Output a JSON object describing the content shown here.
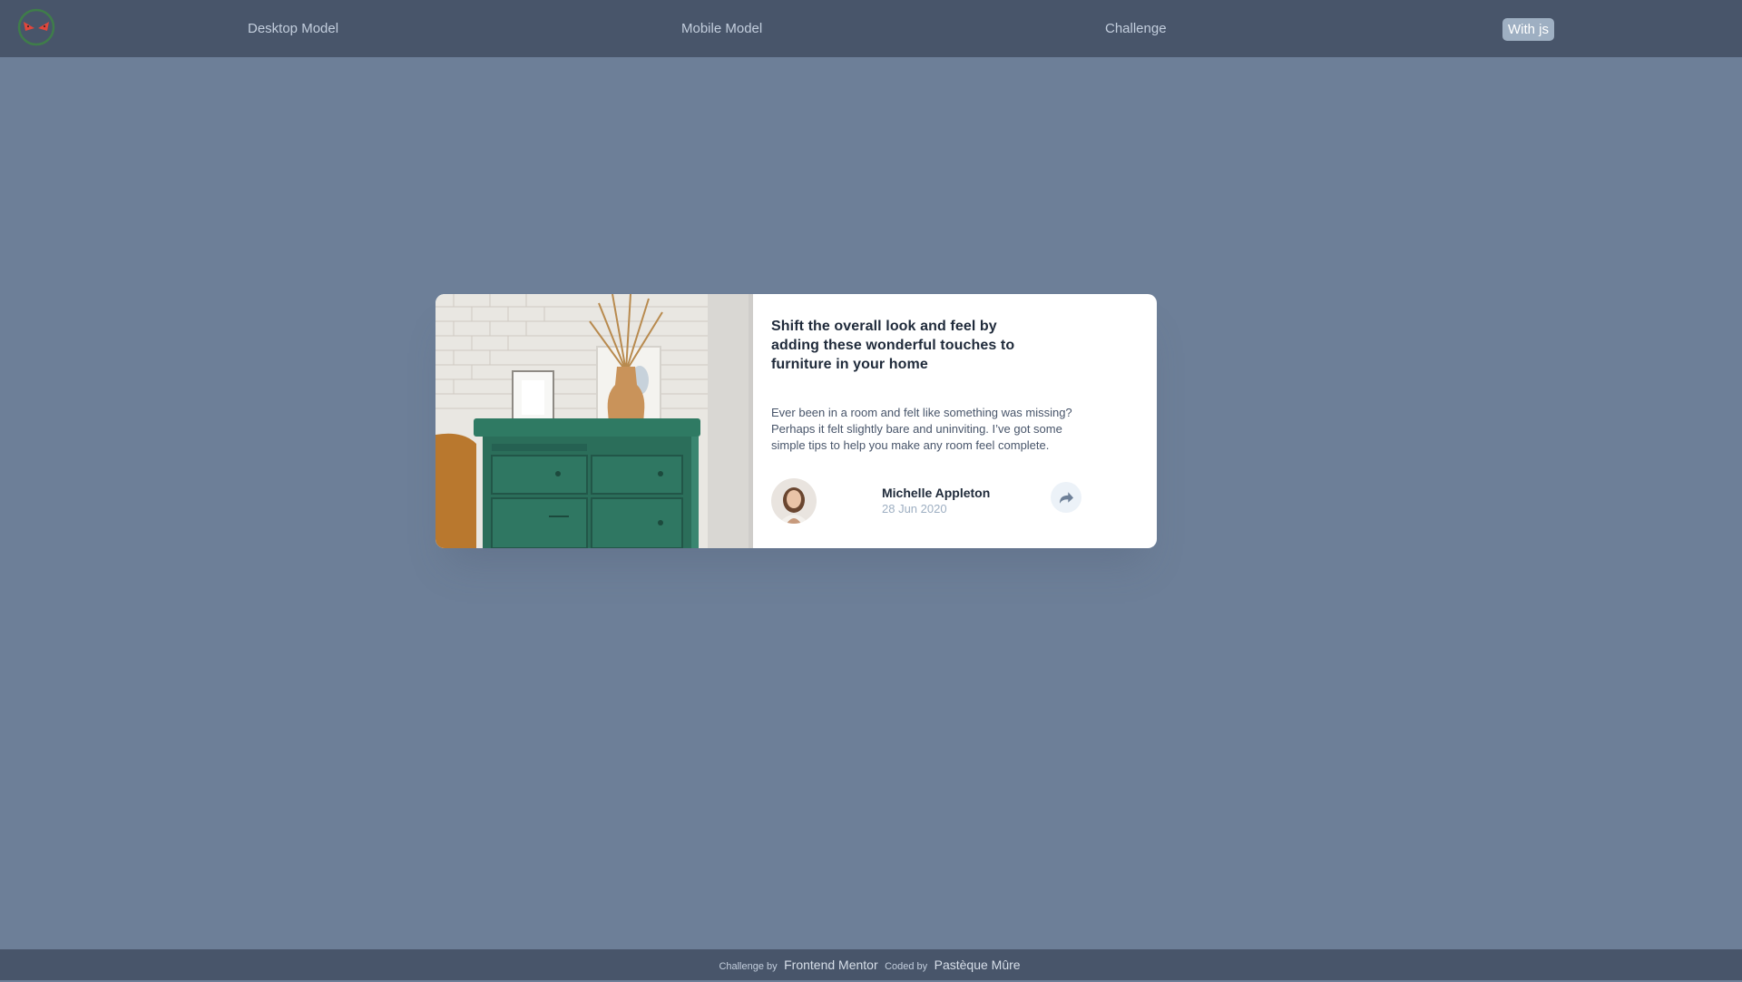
{
  "nav": {
    "logo_icon": "watermelon-logo-icon",
    "desktop_model": "Desktop Model",
    "mobile_model": "Mobile Model",
    "challenge": "Challenge",
    "with_js": "With js"
  },
  "card": {
    "image_icon": "dresser-with-vase-photo",
    "title": "Shift the overall look and feel by adding these wonderful touches to furniture in your home",
    "description": "Ever been in a room and felt like something was missing? Perhaps it felt slightly bare and uninviting. I’ve got some simple tips to help you make any room feel complete.",
    "author": {
      "avatar_icon": "author-avatar-icon",
      "name": "Michelle Appleton",
      "date": "28 Jun 2020"
    },
    "share_icon": "share-arrow-icon"
  },
  "footer": {
    "challenge_by": "Challenge by",
    "frontend_mentor": "Frontend Mentor",
    "coded_by": "Coded by",
    "author": "Pastèque Mûre"
  },
  "colors": {
    "background": "#6d7f98",
    "bar": "#48556a",
    "card": "#ffffff",
    "title": "#1f2a3a",
    "muted": "#9eafc2"
  }
}
